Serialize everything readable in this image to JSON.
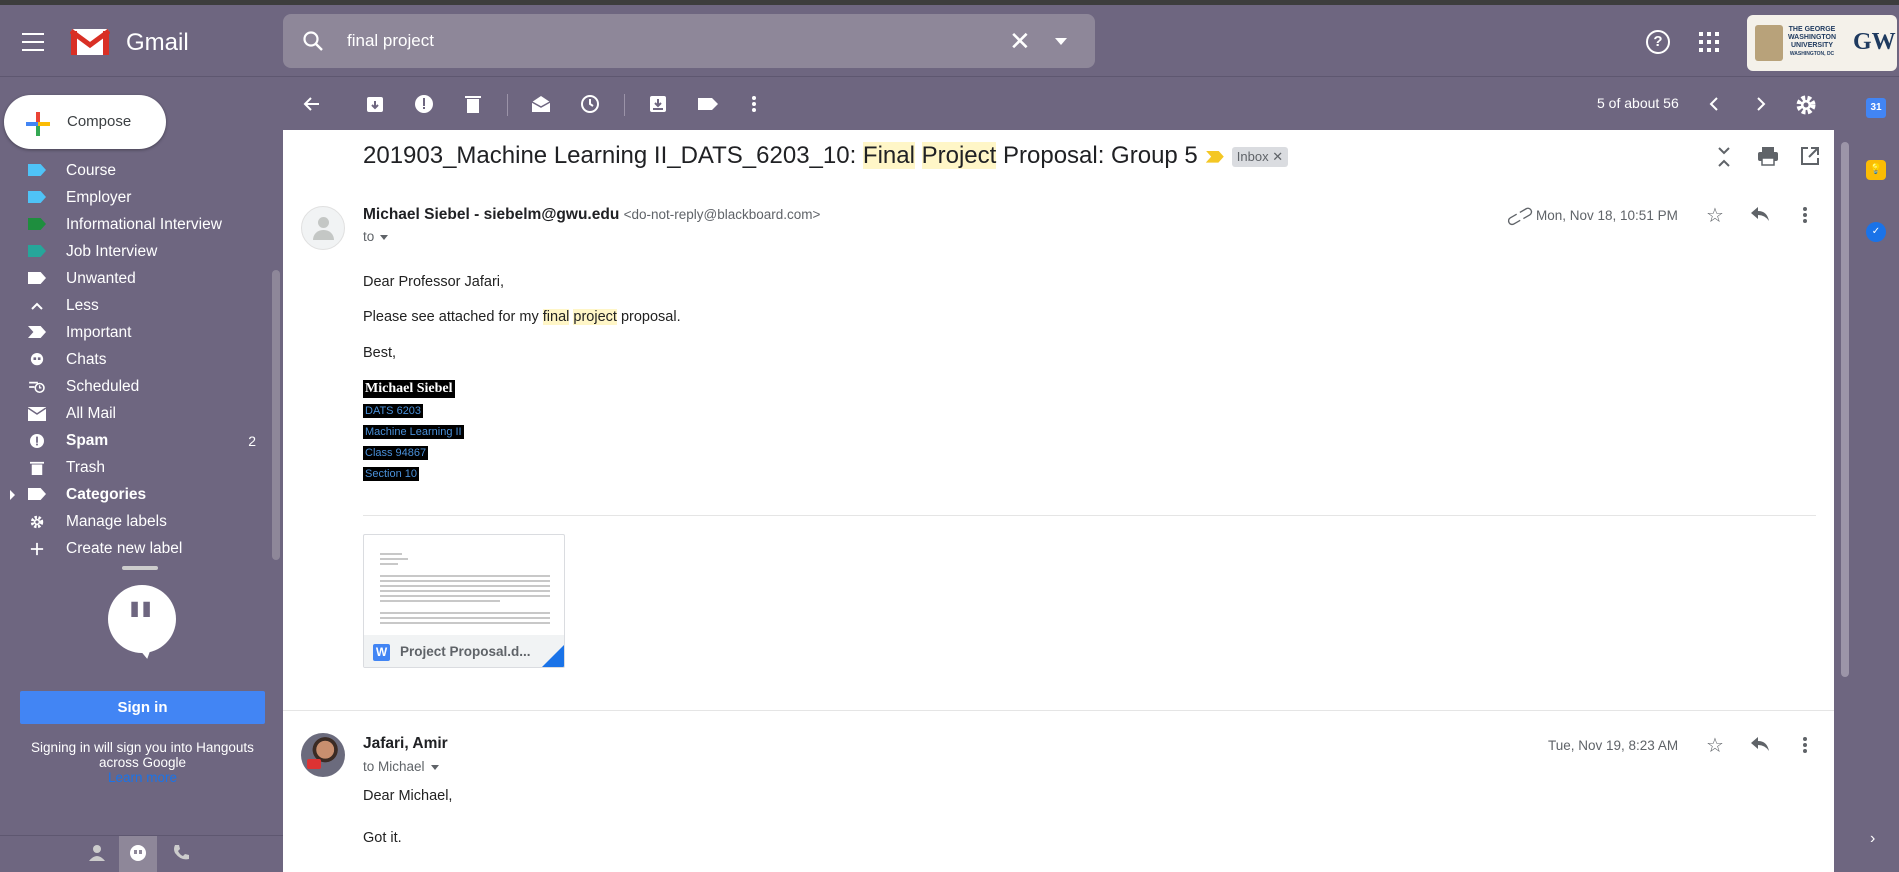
{
  "app": {
    "name": "Gmail"
  },
  "search": {
    "query": "final project"
  },
  "org_logo": {
    "line1": "THE GEORGE",
    "line2": "WASHINGTON",
    "line3": "UNIVERSITY",
    "line4": "WASHINGTON, DC",
    "abbr": "GW"
  },
  "compose": {
    "label": "Compose"
  },
  "sidebar": {
    "items": [
      {
        "label": "Course",
        "icon": "label-icon",
        "color": "#4fc3f7"
      },
      {
        "label": "Employer",
        "icon": "label-icon",
        "color": "#4fc3f7"
      },
      {
        "label": "Informational Interview",
        "icon": "label-icon",
        "color": "#1e8e3e"
      },
      {
        "label": "Job Interview",
        "icon": "label-icon",
        "color": "#26a69a"
      },
      {
        "label": "Unwanted",
        "icon": "label-icon",
        "color": "#ffffff"
      },
      {
        "label": "Less",
        "icon": "chevron-up-icon"
      },
      {
        "label": "Important",
        "icon": "important-icon"
      },
      {
        "label": "Chats",
        "icon": "chat-icon"
      },
      {
        "label": "Scheduled",
        "icon": "scheduled-icon"
      },
      {
        "label": "All Mail",
        "icon": "mail-icon"
      },
      {
        "label": "Spam",
        "icon": "spam-icon",
        "count": "2"
      },
      {
        "label": "Trash",
        "icon": "trash-icon"
      },
      {
        "label": "Categories",
        "icon": "label-icon"
      },
      {
        "label": "Manage labels",
        "icon": "gear-icon"
      },
      {
        "label": "Create new label",
        "icon": "plus-icon"
      }
    ]
  },
  "hangouts": {
    "signin_label": "Sign in",
    "note": "Signing in will sign you into Hangouts across Google",
    "learn_more": "Learn more"
  },
  "toolbar": {
    "pager": "5 of about 56"
  },
  "thread": {
    "subject_prefix": "201903_Machine Learning II_DATS_6203_10: ",
    "subject_hl1": "Final",
    "subject_hl2": "Project",
    "subject_suffix": " Proposal: Group 5",
    "label": "Inbox",
    "messages": [
      {
        "sender": "Michael Siebel - siebelm@gwu.edu",
        "sender_email": "<do-not-reply@blackboard.com>",
        "to": "to",
        "date": "Mon, Nov 18, 10:51 PM",
        "greeting": "Dear Professor Jafari,",
        "line_pre": "Please see attached for my ",
        "line_hl1": "final",
        "line_hl2": "project",
        "line_post": " proposal.",
        "closing": "Best,",
        "sig_name": "Michael Siebel",
        "sig_lines": [
          "DATS 6203",
          "Machine Learning II",
          "Class 94867",
          "Section 10"
        ],
        "attachment": "Project Proposal.d..."
      },
      {
        "sender": "Jafari, Amir",
        "to": "to Michael",
        "date": "Tue, Nov 19, 8:23 AM",
        "greeting": "Dear Michael,",
        "body": "Got it."
      }
    ]
  },
  "side_panel": {
    "calendar_day": "31"
  },
  "colors": {
    "theme_bg": "#6e6680",
    "accent": "#4285f4",
    "highlight": "#fff6c7"
  }
}
